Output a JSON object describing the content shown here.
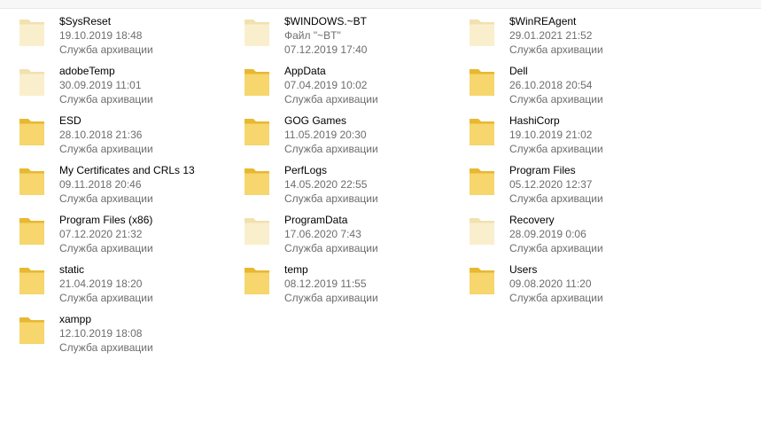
{
  "items": [
    {
      "name": "$SysReset",
      "date": "19.10.2019 18:48",
      "type": "Служба архивации",
      "faded": true
    },
    {
      "name": "$WINDOWS.~BT",
      "date": "Файл \"~BT\"",
      "type": "07.12.2019 17:40",
      "faded": true
    },
    {
      "name": "$WinREAgent",
      "date": "29.01.2021 21:52",
      "type": "Служба архивации",
      "faded": true
    },
    {
      "name": "adobeTemp",
      "date": "30.09.2019 11:01",
      "type": "Служба архивации",
      "faded": true
    },
    {
      "name": "AppData",
      "date": "07.04.2019 10:02",
      "type": "Служба архивации",
      "faded": false
    },
    {
      "name": "Dell",
      "date": "26.10.2018 20:54",
      "type": "Служба архивации",
      "faded": false
    },
    {
      "name": "ESD",
      "date": "28.10.2018 21:36",
      "type": "Служба архивации",
      "faded": false
    },
    {
      "name": "GOG Games",
      "date": "11.05.2019 20:30",
      "type": "Служба архивации",
      "faded": false
    },
    {
      "name": "HashiCorp",
      "date": "19.10.2019 21:02",
      "type": "Служба архивации",
      "faded": false
    },
    {
      "name": "My Certificates and CRLs 13",
      "date": "09.11.2018 20:46",
      "type": "Служба архивации",
      "faded": false
    },
    {
      "name": "PerfLogs",
      "date": "14.05.2020 22:55",
      "type": "Служба архивации",
      "faded": false
    },
    {
      "name": "Program Files",
      "date": "05.12.2020 12:37",
      "type": "Служба архивации",
      "faded": false
    },
    {
      "name": "Program Files (x86)",
      "date": "07.12.2020 21:32",
      "type": "Служба архивации",
      "faded": false
    },
    {
      "name": "ProgramData",
      "date": "17.06.2020 7:43",
      "type": "Служба архивации",
      "faded": true
    },
    {
      "name": "Recovery",
      "date": "28.09.2019 0:06",
      "type": "Служба архивации",
      "faded": true
    },
    {
      "name": "static",
      "date": "21.04.2019 18:20",
      "type": "Служба архивации",
      "faded": false
    },
    {
      "name": "temp",
      "date": "08.12.2019 11:55",
      "type": "Служба архивации",
      "faded": false
    },
    {
      "name": "Users",
      "date": "09.08.2020 11:20",
      "type": "Служба архивации",
      "faded": false
    },
    {
      "name": "xampp",
      "date": "12.10.2019 18:08",
      "type": "Служба архивации",
      "faded": false
    }
  ],
  "colors": {
    "folder_back": "#e8b830",
    "folder_front": "#f6d66d",
    "folder_faded_back": "#f1e1b0",
    "folder_faded_front": "#faefcd",
    "name_text": "#000000",
    "meta_text": "#6d6d6d"
  }
}
